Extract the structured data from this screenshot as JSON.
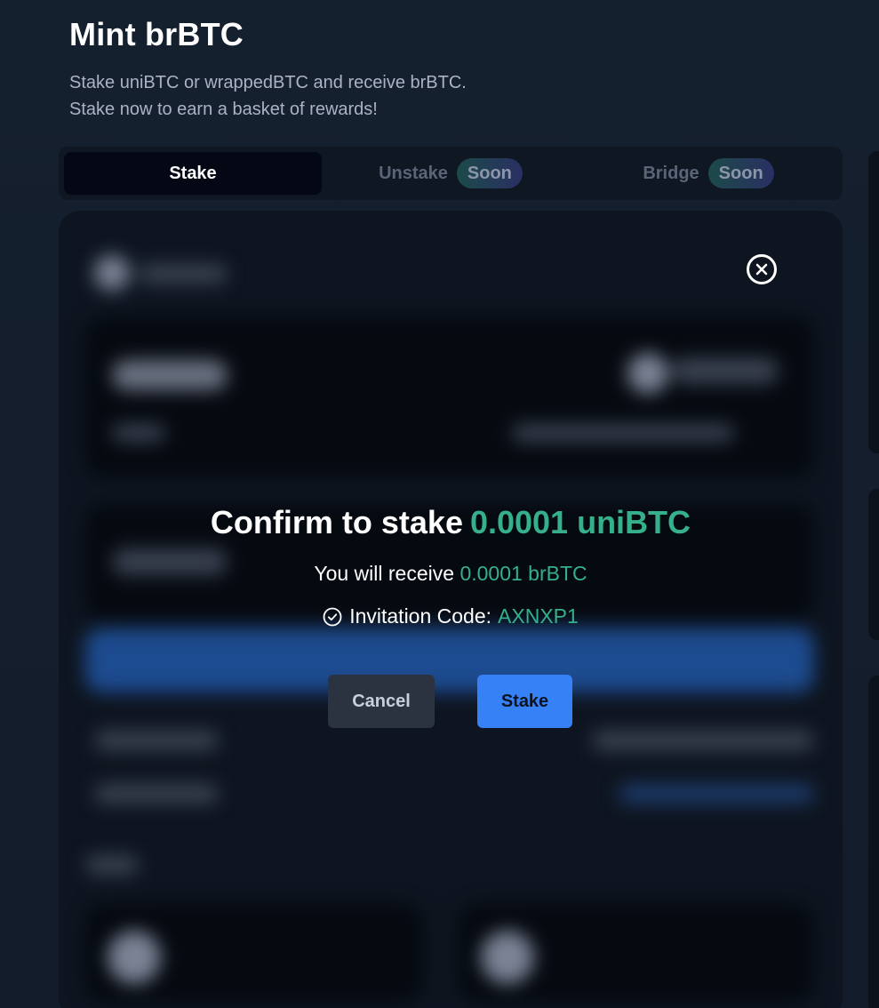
{
  "header": {
    "title": "Mint brBTC",
    "subtitle_line1": "Stake uniBTC or wrappedBTC and receive brBTC.",
    "subtitle_line2": "Stake now to earn a basket of rewards!"
  },
  "tabs": [
    {
      "label": "Stake",
      "active": true
    },
    {
      "label": "Unstake",
      "badge": "Soon"
    },
    {
      "label": "Bridge",
      "badge": "Soon"
    }
  ],
  "modal": {
    "confirm_prefix": "Confirm to stake",
    "confirm_amount": "0.0001 uniBTC",
    "receive_prefix": "You will receive",
    "receive_amount": "0.0001 brBTC",
    "invite_label": "Invitation Code:",
    "invite_code": "AXNXP1",
    "cancel_label": "Cancel",
    "stake_label": "Stake"
  },
  "colors": {
    "accent_green": "#35b08a",
    "primary_blue": "#3681f5",
    "background": "#15202f"
  },
  "icons": {
    "close": "close-circle-icon",
    "check": "check-circle-icon"
  }
}
